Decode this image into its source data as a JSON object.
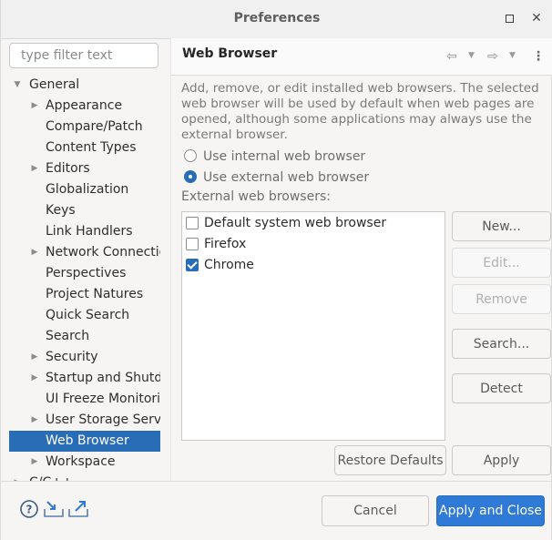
{
  "window": {
    "title": "Preferences"
  },
  "filter": {
    "placeholder": "type filter text"
  },
  "tree": {
    "root": "General",
    "items": [
      {
        "label": "Appearance",
        "expandable": true
      },
      {
        "label": "Compare/Patch",
        "expandable": false
      },
      {
        "label": "Content Types",
        "expandable": false
      },
      {
        "label": "Editors",
        "expandable": true
      },
      {
        "label": "Globalization",
        "expandable": false
      },
      {
        "label": "Keys",
        "expandable": false
      },
      {
        "label": "Link Handlers",
        "expandable": false
      },
      {
        "label": "Network Connectio",
        "expandable": true
      },
      {
        "label": "Perspectives",
        "expandable": false
      },
      {
        "label": "Project Natures",
        "expandable": false
      },
      {
        "label": "Quick Search",
        "expandable": false
      },
      {
        "label": "Search",
        "expandable": false
      },
      {
        "label": "Security",
        "expandable": true
      },
      {
        "label": "Startup and Shutdo",
        "expandable": true
      },
      {
        "label": "UI Freeze Monitorir",
        "expandable": false
      },
      {
        "label": "User Storage Servic",
        "expandable": true
      },
      {
        "label": "Web Browser",
        "expandable": false,
        "selected": true
      },
      {
        "label": "Workspace",
        "expandable": true
      }
    ],
    "next_partial": "C/C++"
  },
  "page": {
    "title": "Web Browser",
    "description": "Add, remove, or edit installed web browsers. The selected web browser will be used by default when web pages are opened, although some applications may always use the external browser.",
    "radio_internal": "Use internal web browser",
    "radio_external": "Use external web browser",
    "selected_mode": "external",
    "list_label": "External web browsers:",
    "browsers": [
      {
        "label": "Default system web browser",
        "checked": false
      },
      {
        "label": "Firefox",
        "checked": false
      },
      {
        "label": "Chrome",
        "checked": true
      }
    ]
  },
  "buttons": {
    "new": "New...",
    "edit": "Edit...",
    "remove": "Remove",
    "search": "Search...",
    "detect": "Detect",
    "restore_defaults": "Restore Defaults",
    "apply": "Apply",
    "cancel": "Cancel",
    "apply_close": "Apply and Close"
  },
  "icons": {
    "help": "help-icon",
    "import": "import-icon",
    "export": "export-icon",
    "back": "back-arrow-icon",
    "forward": "forward-arrow-icon",
    "menu": "view-menu-icon",
    "maximize": "maximize-icon",
    "close": "close-icon"
  },
  "colors": {
    "selection": "#2a6db7",
    "primary_button": "#2f7ad6"
  }
}
